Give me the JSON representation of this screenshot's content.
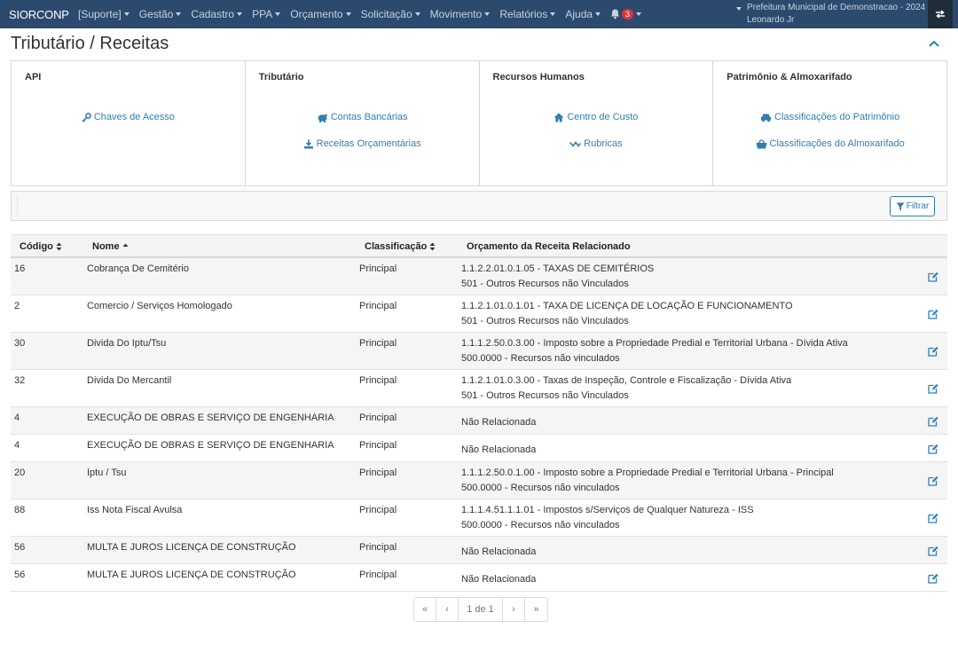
{
  "navbar": {
    "brand": "SIORCONP",
    "menu": [
      {
        "label": "[Suporte]"
      },
      {
        "label": "Gestão"
      },
      {
        "label": "Cadastro"
      },
      {
        "label": "PPA"
      },
      {
        "label": "Orçamento"
      },
      {
        "label": "Solicitação"
      },
      {
        "label": "Movimento"
      },
      {
        "label": "Relatórios"
      },
      {
        "label": "Ajuda"
      }
    ],
    "notification_count": "3",
    "org_name": "Prefeitura Municipal de Demonstracao - 2024",
    "user_name": "Leonardo Jr",
    "bg_color": "#2b4a6e"
  },
  "page": {
    "title": "Tributário / Receitas"
  },
  "panels": [
    {
      "title": "API",
      "links": [
        {
          "label": "Chaves de Acesso",
          "icon": "key-icon"
        }
      ]
    },
    {
      "title": "Tributário",
      "links": [
        {
          "label": "Contas Bancárias",
          "icon": "bank-icon"
        },
        {
          "label": "Receitas Orçamentárias",
          "icon": "download-icon"
        }
      ]
    },
    {
      "title": "Recursos Humanos",
      "links": [
        {
          "label": "Centro de Custo",
          "icon": "home-icon"
        },
        {
          "label": "Rubricas",
          "icon": "chart-line-icon"
        }
      ]
    },
    {
      "title": "Patrimônio & Almoxarifado",
      "links": [
        {
          "label": "Classificações do Patrimônio",
          "icon": "car-icon"
        },
        {
          "label": "Classificações do Almoxarifado",
          "icon": "basket-icon"
        }
      ]
    }
  ],
  "filter": {
    "button_label": "Filtrar"
  },
  "table": {
    "headers": {
      "code": "Código",
      "name": "Nome",
      "classification": "Classificação",
      "budget": "Orçamento da Receita Relacionado"
    },
    "rows": [
      {
        "code": "16",
        "name": "Cobrança De Cemitério",
        "classification": "Principal",
        "budget_line1": "1.1.2.2.01.0.1.05 - TAXAS DE CEMITÉRIOS",
        "budget_line2": "501 - Outros Recursos não Vinculados"
      },
      {
        "code": "2",
        "name": "Comercio / Serviços Homologado",
        "classification": "Principal",
        "budget_line1": "1.1.2.1.01.0.1.01 - TAXA DE LICENÇA DE LOCAÇÃO E FUNCIONAMENTO",
        "budget_line2": "501 - Outros Recursos não Vinculados"
      },
      {
        "code": "30",
        "name": "Divida Do Iptu/Tsu",
        "classification": "Principal",
        "budget_line1": "1.1.1.2.50.0.3.00 - Imposto sobre a Propriedade Predial e Territorial Urbana - Dívida Ativa",
        "budget_line2": "500.0000 - Recursos não vinculados"
      },
      {
        "code": "32",
        "name": "Divida Do Mercantil",
        "classification": "Principal",
        "budget_line1": "1.1.2.1.01.0.3.00 - Taxas de Inspeção, Controle e Fiscalização - Dívida Ativa",
        "budget_line2": "501 - Outros Recursos não Vinculados"
      },
      {
        "code": "4",
        "name": "EXECUÇÃO DE OBRAS E SERVIÇO DE ENGENHARIA",
        "classification": "Principal",
        "budget_line1": "Não Relacionada",
        "budget_line2": ""
      },
      {
        "code": "4",
        "name": "EXECUÇÃO DE OBRAS E SERVIÇO DE ENGENHARIA",
        "classification": "Principal",
        "budget_line1": "Não Relacionada",
        "budget_line2": ""
      },
      {
        "code": "20",
        "name": "Iptu / Tsu",
        "classification": "Principal",
        "budget_line1": "1.1.1.2.50.0.1.00 - Imposto sobre a Propriedade Predial e Territorial Urbana - Principal",
        "budget_line2": "500.0000 - Recursos não vinculados"
      },
      {
        "code": "88",
        "name": "Iss Nota Fiscal Avulsa",
        "classification": "Principal",
        "budget_line1": "1.1.1.4.51.1.1.01 - Impostos s/Serviços de Qualquer Natureza - ISS",
        "budget_line2": "500.0000 - Recursos não vinculados"
      },
      {
        "code": "56",
        "name": "MULTA E JUROS LICENÇA DE CONSTRUÇÃO",
        "classification": "Principal",
        "budget_line1": "Não Relacionada",
        "budget_line2": ""
      },
      {
        "code": "56",
        "name": "MULTA E JUROS LICENÇA DE CONSTRUÇÃO",
        "classification": "Principal",
        "budget_line1": "Não Relacionada",
        "budget_line2": ""
      }
    ]
  },
  "pagination": {
    "first": "«",
    "prev": "‹",
    "current": "1 de 1",
    "next": "›",
    "last": "»"
  }
}
